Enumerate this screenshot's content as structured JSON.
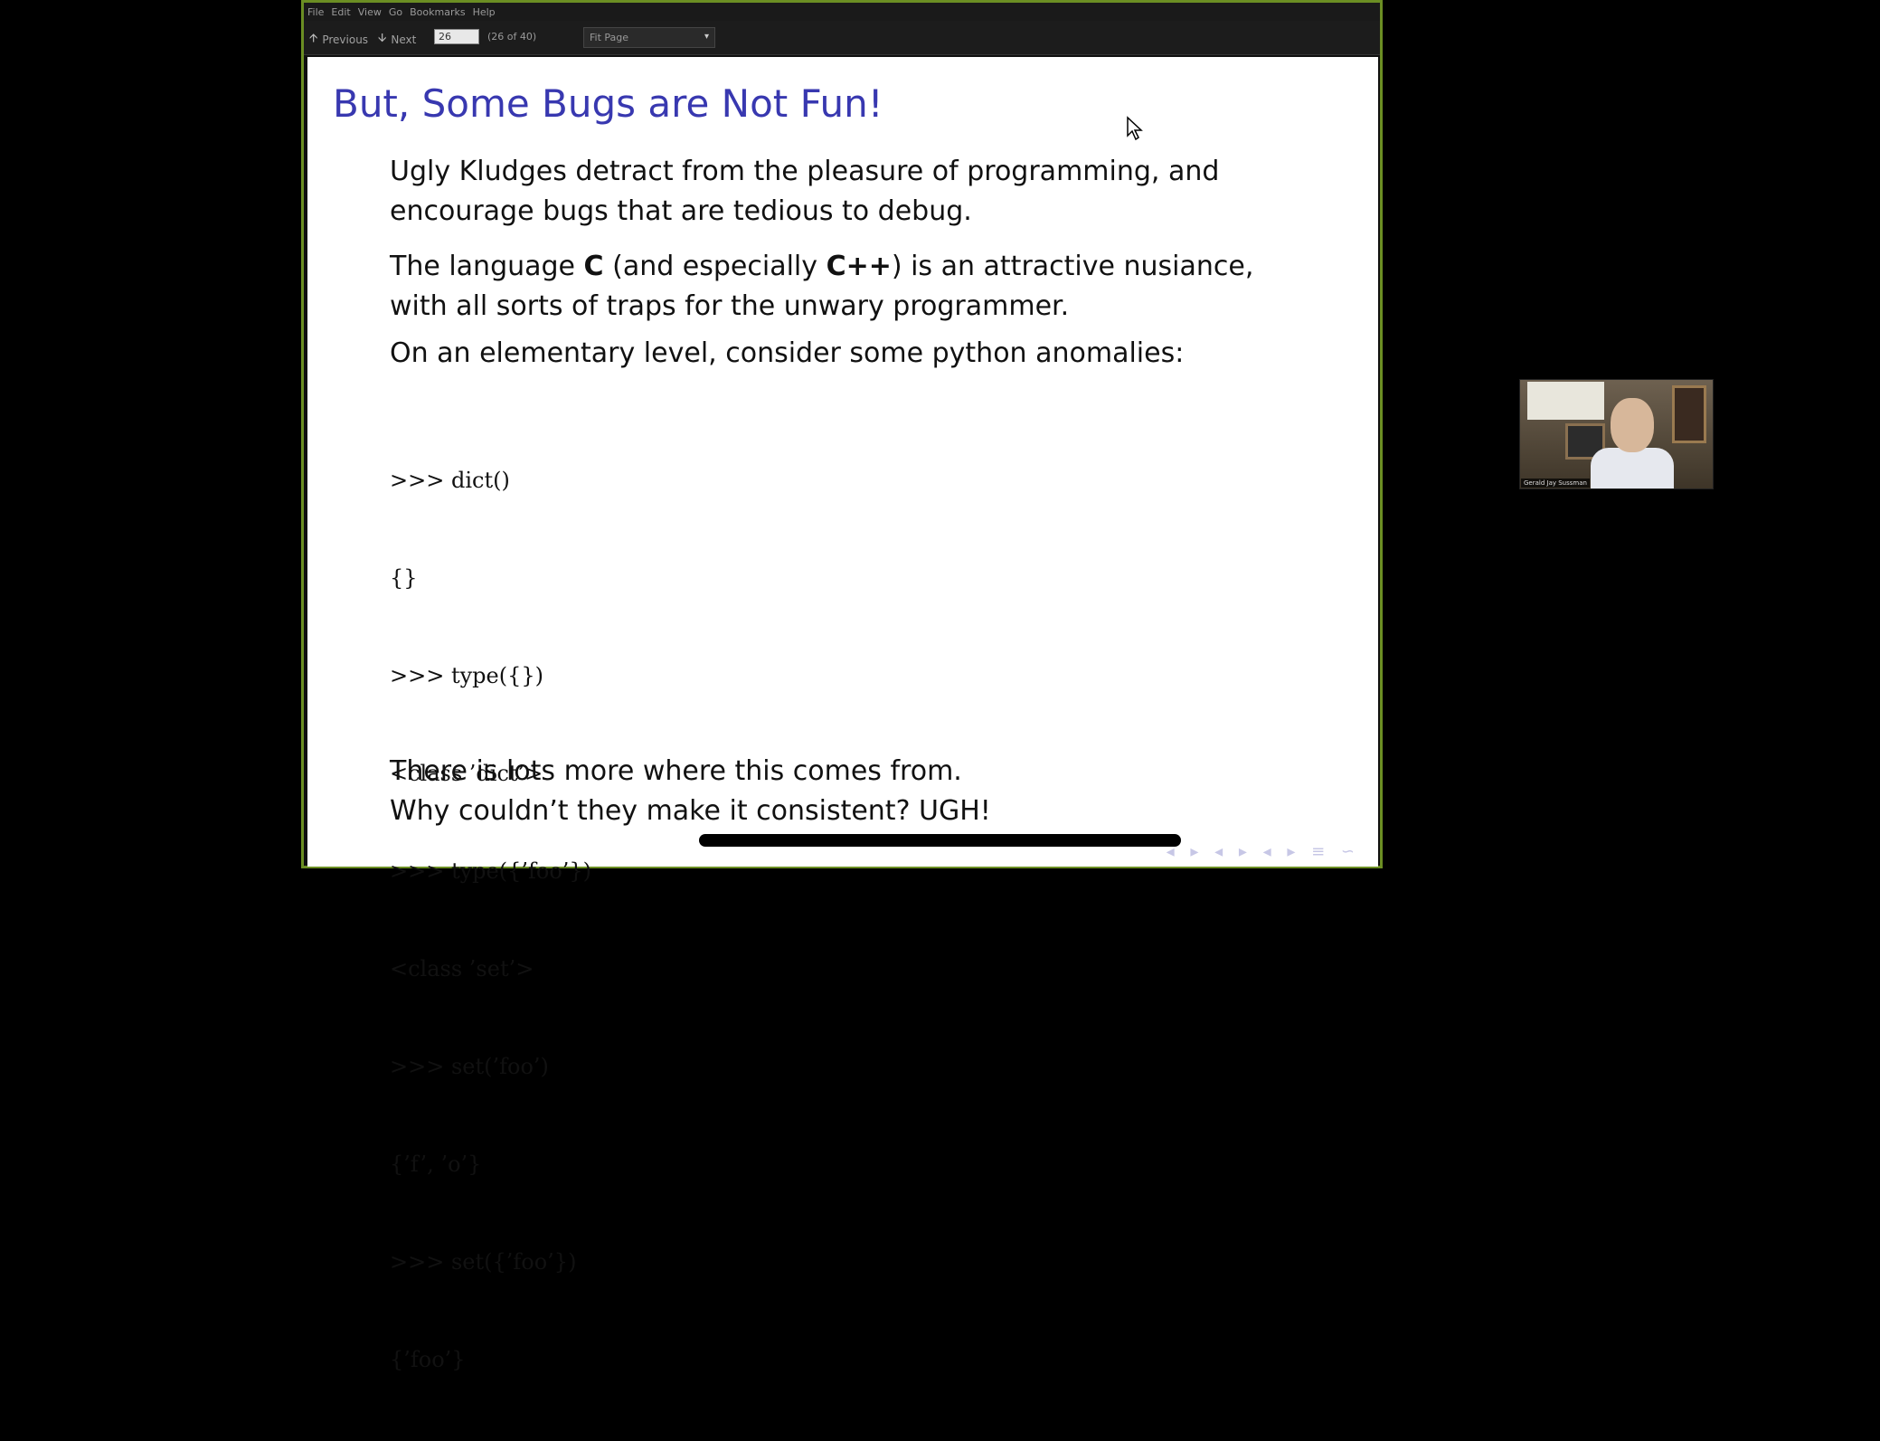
{
  "menu": [
    "File",
    "Edit",
    "View",
    "Go",
    "Bookmarks",
    "Help"
  ],
  "toolbar": {
    "previous_label": "Previous",
    "next_label": "Next",
    "page_value": "26",
    "page_count": "(26 of 40)",
    "zoom_value": "Fit Page"
  },
  "slide": {
    "title": "But, Some Bugs are Not Fun!",
    "para1_line1": "Ugly Kludges detract from the pleasure of programming, and",
    "para1_line2": "encourage bugs that are tedious to debug.",
    "para2_pre": "The language ",
    "para2_c": "C",
    "para2_mid": " (and especially ",
    "para2_cpp": "C++",
    "para2_post": ") is an attractive nusiance,",
    "para2_line2": "with all sorts of traps for the unwary programmer.",
    "para3": "On an elementary level, consider some python anomalies:",
    "code_lines": [
      ">>> dict()",
      "{}",
      ">>> type({})",
      "<class ’dict’>",
      ">>> type({’foo’})",
      "<class ’set’>",
      ">>> set(’foo’)",
      "{’f’, ’o’}",
      ">>> set({’foo’})",
      "{’foo’}"
    ],
    "closing_line1": "There is lots more where this comes from.",
    "closing_line2": "Why couldn’t they make it consistent? UGH!"
  },
  "webcam": {
    "name_label": "Gerald Jay Sussman"
  },
  "icons": [
    "arrow-up-icon",
    "arrow-down-icon",
    "chevron-down-icon",
    "cursor-icon"
  ]
}
